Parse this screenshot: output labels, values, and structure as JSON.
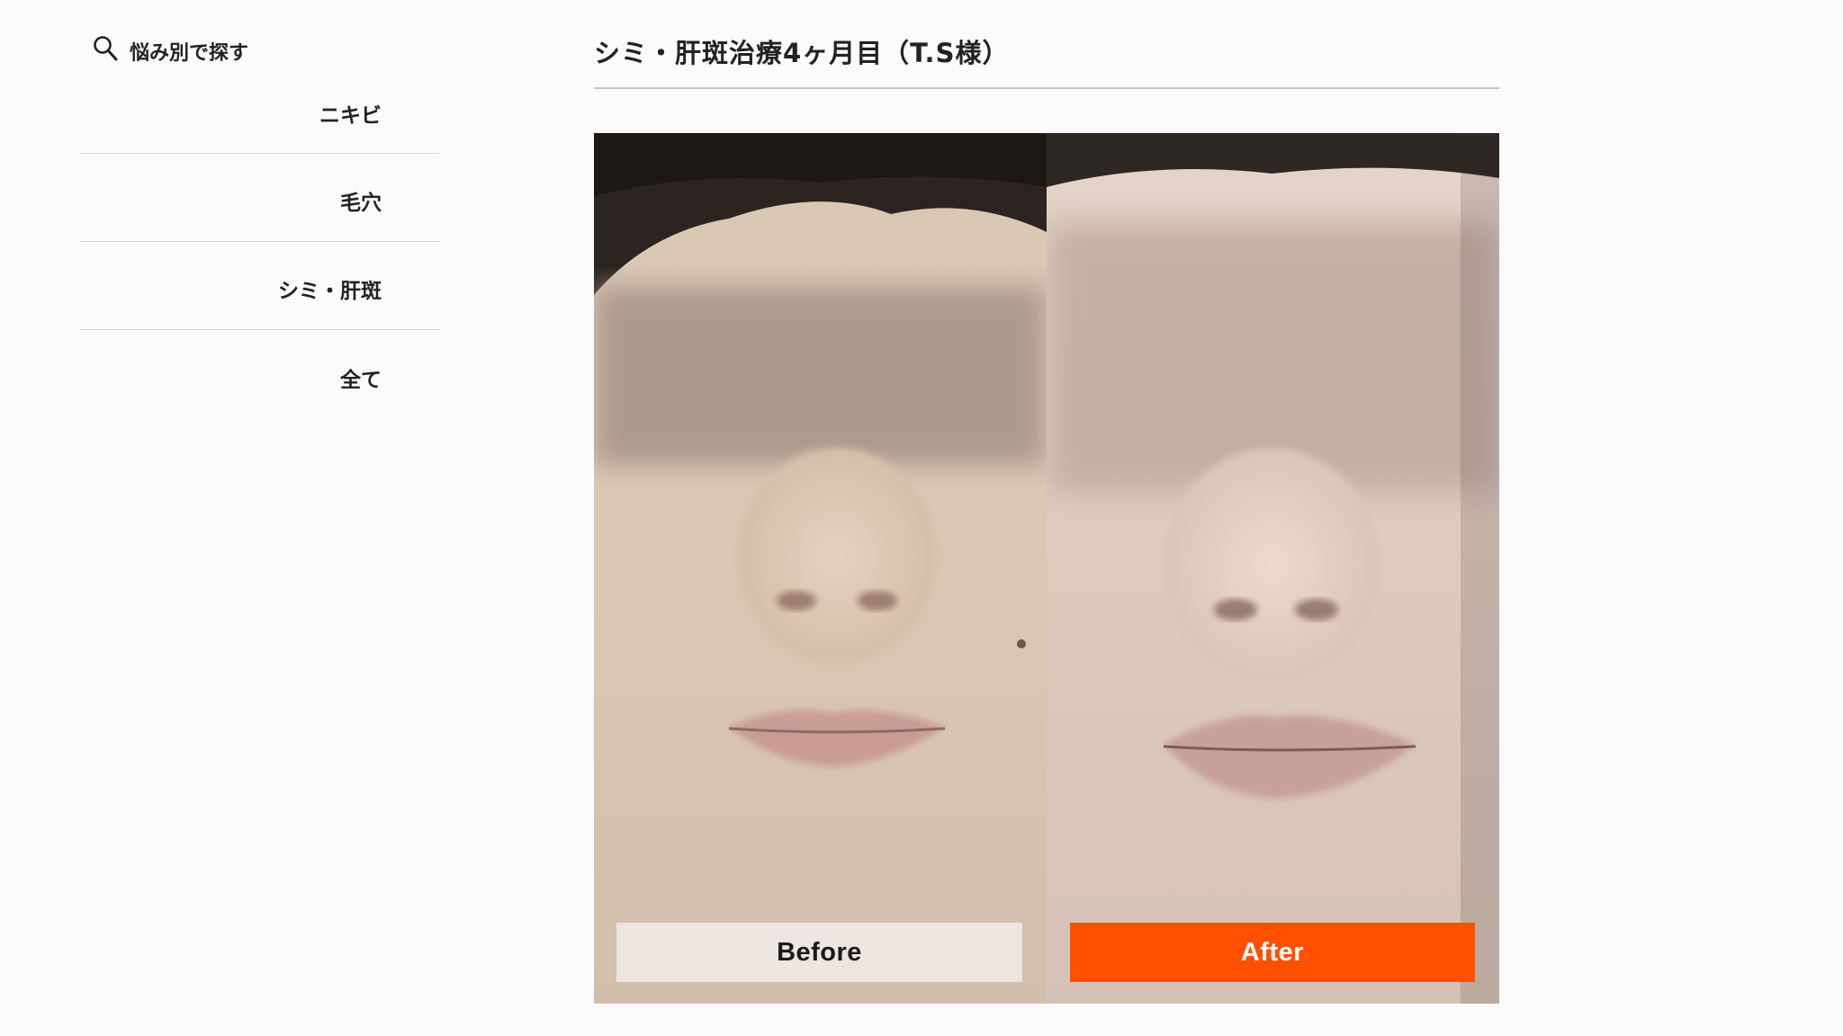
{
  "sidebar": {
    "search_label": "悩み別で探す",
    "items": [
      {
        "label": "ニキビ"
      },
      {
        "label": "毛穴"
      },
      {
        "label": "シミ・肝斑"
      },
      {
        "label": "全て"
      }
    ]
  },
  "main": {
    "title": "シミ・肝斑治療4ヶ月目（T.S様）",
    "before_label": "Before",
    "after_label": "After"
  },
  "colors": {
    "background": "#fcfafa",
    "after_accent": "#ff5000",
    "before_tag": "#ede5df"
  }
}
